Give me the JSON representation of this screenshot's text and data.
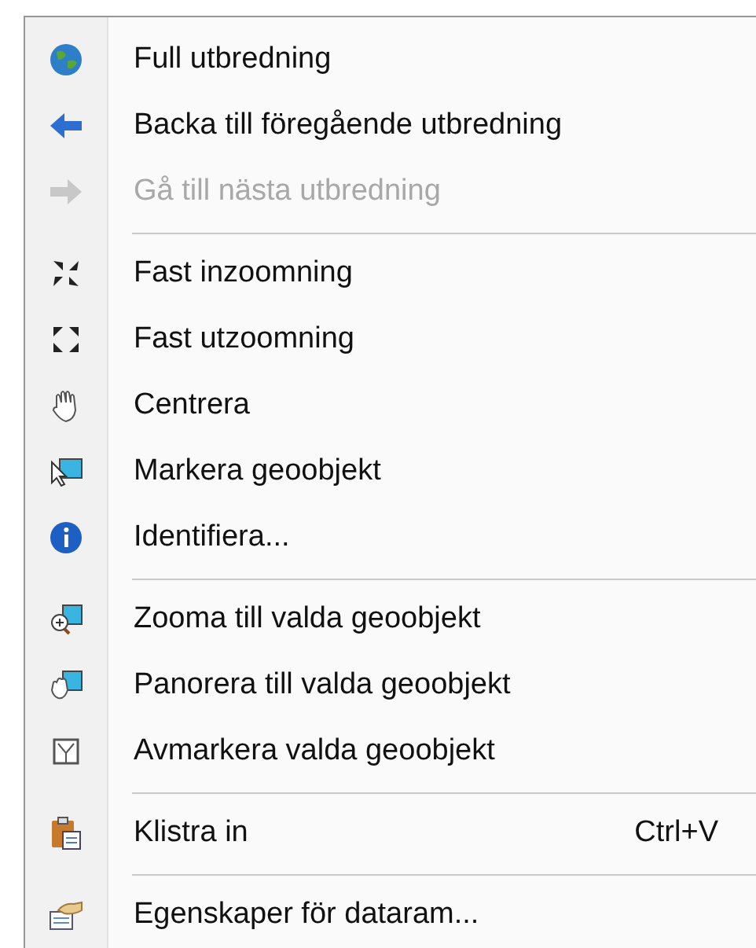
{
  "menu": {
    "groups": [
      {
        "items": [
          {
            "label": "Full utbredning",
            "disabled": false
          },
          {
            "label": "Backa till föregående utbredning",
            "disabled": false
          },
          {
            "label": "Gå till nästa utbredning",
            "disabled": true
          }
        ]
      },
      {
        "items": [
          {
            "label": "Fast inzoomning",
            "disabled": false
          },
          {
            "label": "Fast utzoomning",
            "disabled": false
          },
          {
            "label": "Centrera",
            "disabled": false
          },
          {
            "label": "Markera geoobjekt",
            "disabled": false
          },
          {
            "label": "Identifiera...",
            "disabled": false
          }
        ]
      },
      {
        "items": [
          {
            "label": "Zooma till valda geoobjekt",
            "disabled": false
          },
          {
            "label": "Panorera till valda geoobjekt",
            "disabled": false
          },
          {
            "label": "Avmarkera valda geoobjekt",
            "disabled": false
          }
        ]
      },
      {
        "items": [
          {
            "label": "Klistra in",
            "shortcut": "Ctrl+V",
            "disabled": false
          }
        ]
      },
      {
        "items": [
          {
            "label": "Egenskaper för dataram...",
            "disabled": false
          }
        ]
      }
    ]
  }
}
